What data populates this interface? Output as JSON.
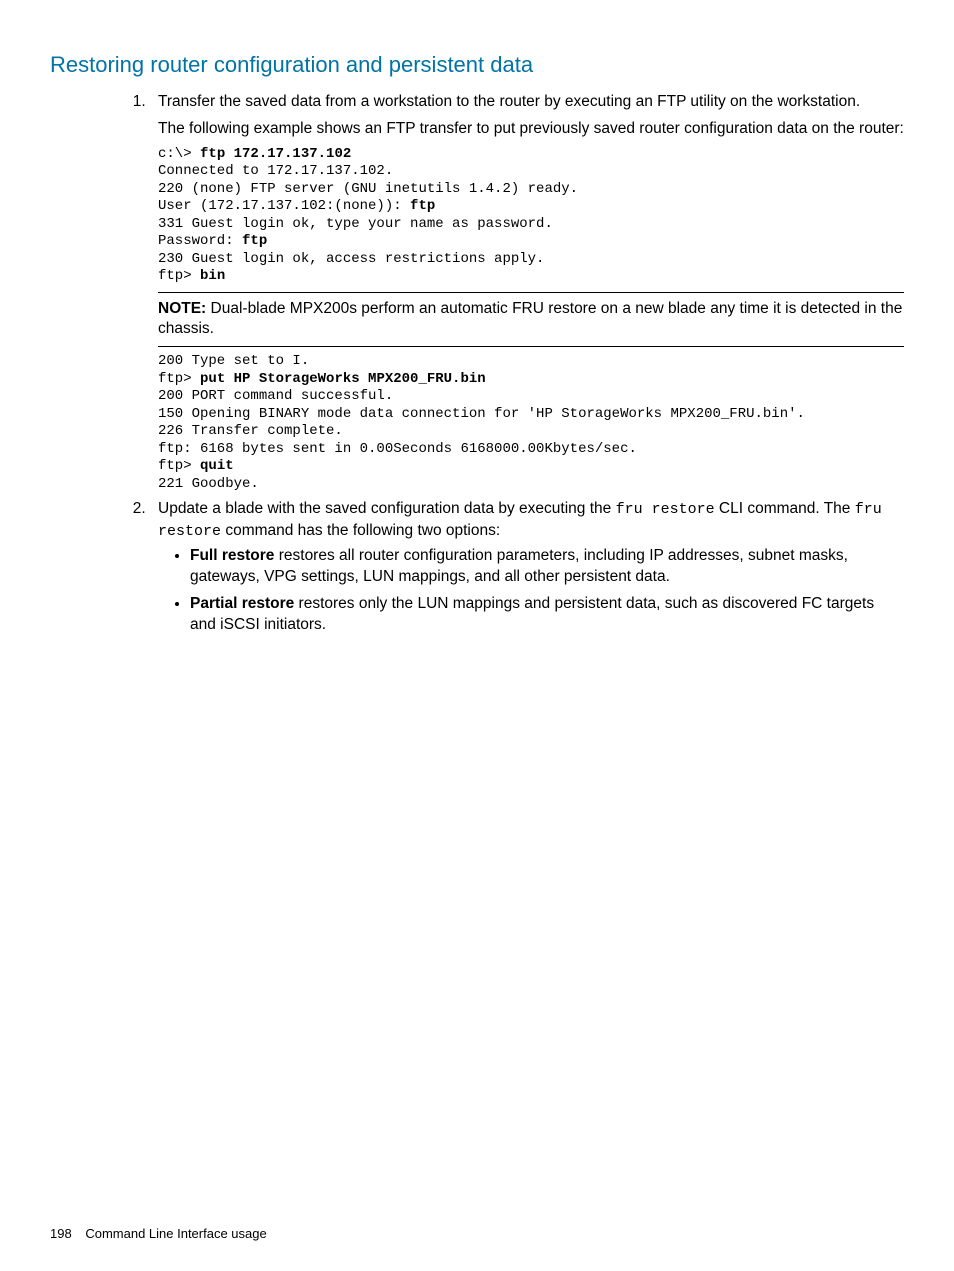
{
  "heading": "Restoring router configuration and persistent data",
  "step1": {
    "p1": "Transfer the saved data from a workstation to the router by executing an FTP utility on the workstation.",
    "p2": "The following example shows an FTP transfer to put previously saved router configuration data on the router:",
    "code1_l1a": "c:\\> ",
    "code1_l1b": "ftp 172.17.137.102",
    "code1_l2": "Connected to 172.17.137.102.",
    "code1_l3": "220 (none) FTP server (GNU inetutils 1.4.2) ready.",
    "code1_l4a": "User (172.17.137.102:(none)): ",
    "code1_l4b": "ftp",
    "code1_l5": "331 Guest login ok, type your name as password.",
    "code1_l6a": "Password: ",
    "code1_l6b": "ftp",
    "code1_l7": "230 Guest login ok, access restrictions apply.",
    "code1_l8a": "ftp> ",
    "code1_l8b": "bin",
    "note_label": "NOTE:",
    "note_text": " Dual-blade MPX200s perform an automatic FRU restore on a new blade any time it is detected in the chassis.",
    "code2_l1": "200 Type set to I.",
    "code2_l2a": "ftp> ",
    "code2_l2b": "put HP StorageWorks MPX200_FRU.bin",
    "code2_l3": "200 PORT command successful.",
    "code2_l4": "150 Opening BINARY mode data connection for 'HP StorageWorks MPX200_FRU.bin'.",
    "code2_l5": "226 Transfer complete.",
    "code2_l6": "ftp: 6168 bytes sent in 0.00Seconds 6168000.00Kbytes/sec.",
    "code2_l7a": "ftp> ",
    "code2_l7b": "quit",
    "code2_l8": "221 Goodbye."
  },
  "step2": {
    "p1a": "Update a blade with the saved configuration data by executing the ",
    "p1b": "fru restore",
    "p1c": " CLI command. The ",
    "p1d": "fru restore",
    "p1e": " command has the following two options:",
    "b1_label": "Full restore",
    "b1_text": " restores all router configuration parameters, including IP addresses, subnet masks, gateways, VPG settings, LUN mappings, and all other persistent data.",
    "b2_label": "Partial restore",
    "b2_text": " restores only the LUN mappings and persistent data, such as discovered FC targets and iSCSI initiators."
  },
  "footer": {
    "page": "198",
    "section": "Command Line Interface usage"
  }
}
